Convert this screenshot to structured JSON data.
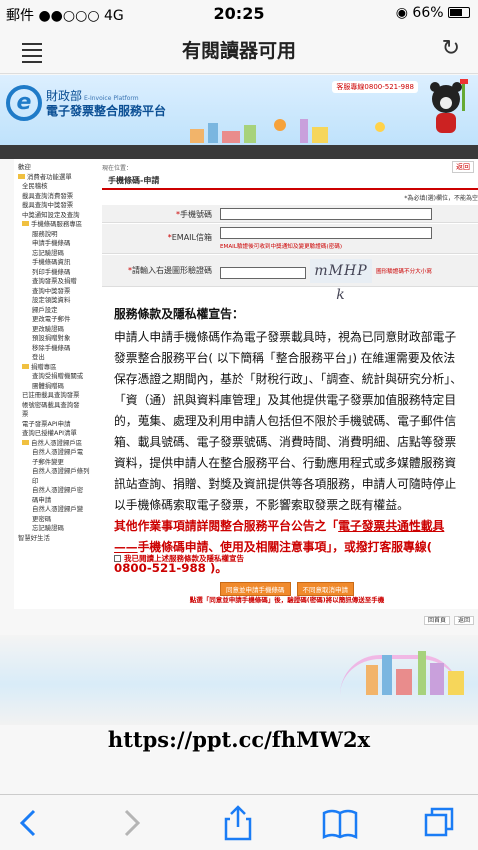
{
  "status": {
    "carrier": "郵件",
    "signal": "●●○○○",
    "network": "4G",
    "time": "20:25",
    "battery": "66%",
    "battery_level": 0.66
  },
  "navbar": {
    "title": "有閱讀器可用"
  },
  "banner": {
    "org": "財政部",
    "org_en": "E-Invoice Platform",
    "platform": "電子發票整合服務平台",
    "phone": "客服專線0800-521-988"
  },
  "sidebar": {
    "title": "歡迎",
    "items": [
      {
        "label": "消費者功能選單",
        "level": 0,
        "folder": true
      },
      {
        "label": "全民稽核",
        "level": 1
      },
      {
        "label": "載具查詢消費發票",
        "level": 1
      },
      {
        "label": "載具查詢中獎發票",
        "level": 1
      },
      {
        "label": "中獎通知設定及查詢",
        "level": 1
      },
      {
        "label": "手機條碼服務專區",
        "level": 1,
        "folder": true
      },
      {
        "label": "服務說明",
        "level": 2
      },
      {
        "label": "申請手機條碼",
        "level": 2
      },
      {
        "label": "忘記驗證碼",
        "level": 2
      },
      {
        "label": "手機條碼資訊",
        "level": 2
      },
      {
        "label": "列印手機條碼",
        "level": 2
      },
      {
        "label": "查詢發票及捐贈",
        "level": 2
      },
      {
        "label": "查詢中獎發票",
        "level": 2
      },
      {
        "label": "設定領獎資料",
        "level": 2
      },
      {
        "label": "歸戶設定",
        "level": 2
      },
      {
        "label": "更改電子郵件",
        "level": 2
      },
      {
        "label": "更改驗證碼",
        "level": 2
      },
      {
        "label": "預設捐贈對象",
        "level": 2
      },
      {
        "label": "移除手機條碼",
        "level": 2
      },
      {
        "label": "登出",
        "level": 2
      },
      {
        "label": "捐贈專區",
        "level": 1,
        "folder": true
      },
      {
        "label": "查詢受捐贈機關或",
        "level": 2
      },
      {
        "label": "團體捐贈碼",
        "level": 2
      },
      {
        "label": "已註冊載具查詢發票",
        "level": 1
      },
      {
        "label": "帳號密碼載具查詢發",
        "level": 1
      },
      {
        "label": "票",
        "level": 1
      },
      {
        "label": "電子發票API申請",
        "level": 1
      },
      {
        "label": "查詢已授權API清單",
        "level": 1
      },
      {
        "label": "自然人憑證歸戶區",
        "level": 1,
        "folder": true
      },
      {
        "label": "自然人憑證歸戶電",
        "level": 2
      },
      {
        "label": "子郵件變更",
        "level": 2
      },
      {
        "label": "自然人憑證歸戶條列",
        "level": 2
      },
      {
        "label": "印",
        "level": 2
      },
      {
        "label": "自然人憑證歸戶密",
        "level": 2
      },
      {
        "label": "碼申請",
        "level": 2
      },
      {
        "label": "自然人憑證歸戶變",
        "level": 2
      },
      {
        "label": "更密碼",
        "level": 2
      },
      {
        "label": "忘記驗證碼",
        "level": 2
      },
      {
        "label": "智慧好生活",
        "level": 0
      }
    ]
  },
  "main": {
    "breadcrumb": "現在位置：",
    "back": "返回",
    "form_title": "手機條碼-申請",
    "required_note": "*為必填(選)欄位，不能為空",
    "fields": {
      "phone_label": "手機號碼",
      "email_label": "EMAIL信箱",
      "email_note": "EMAIL驗證後可收到中獎通知及變更驗證碼(密碼)",
      "captcha_label": "請輸入右邊圖形驗證碼",
      "captcha_text": "mMHP k",
      "captcha_note": "圖形驗證碼不分大小寫",
      "star": "*"
    },
    "terms": {
      "heading": "服務條款及隱私權宣告：",
      "body": "申請人申請手機條碼作為電子發票載具時，視為已同意財政部電子發票整合服務平台( 以下簡稱「整合服務平台」) 在維運需要及依法保存憑證之期間內，基於「財稅行政」、「調查、統計與研究分析」、「資（通）訊與資料庫管理」及其他提供電子發票加值服務特定目的，蒐集、處理及利用申請人包括但不限於手機號碼、電子郵件信箱、載具號碼、電子發票號碼、消費時間、消費明細、店點等發票資料，提供申請人在整合服務平台、行動應用程式或多媒體服務資訊站查詢、捐贈、對獎及資訊提供等各項服務，申請人可隨時停止以手機條碼索取電子發票，不影響索取發票之既有權益。",
      "red_part1": "其他作業事項請詳閱整合服務平台公告之「",
      "red_link": "電子發票共通性載具——",
      "red_part2": "手機條碼申請、使用及相關注意事項」，",
      "red_call": "或撥打客服專線( 0800-521-988 )",
      "red_end": "。"
    },
    "agree_label": "我已閱讀上述服務條款及隱私權宣告",
    "agree_button": "同意並申請手機條碼",
    "cancel_button": "不同意取消申請",
    "hint": "點選「同意並申請手機條碼」後，驗證碼(密碼)將以簡訊傳送至手機",
    "nav_home": "回首頁",
    "nav_back": "返回"
  },
  "url_overlay": "https://ppt.cc/fhMW2x"
}
